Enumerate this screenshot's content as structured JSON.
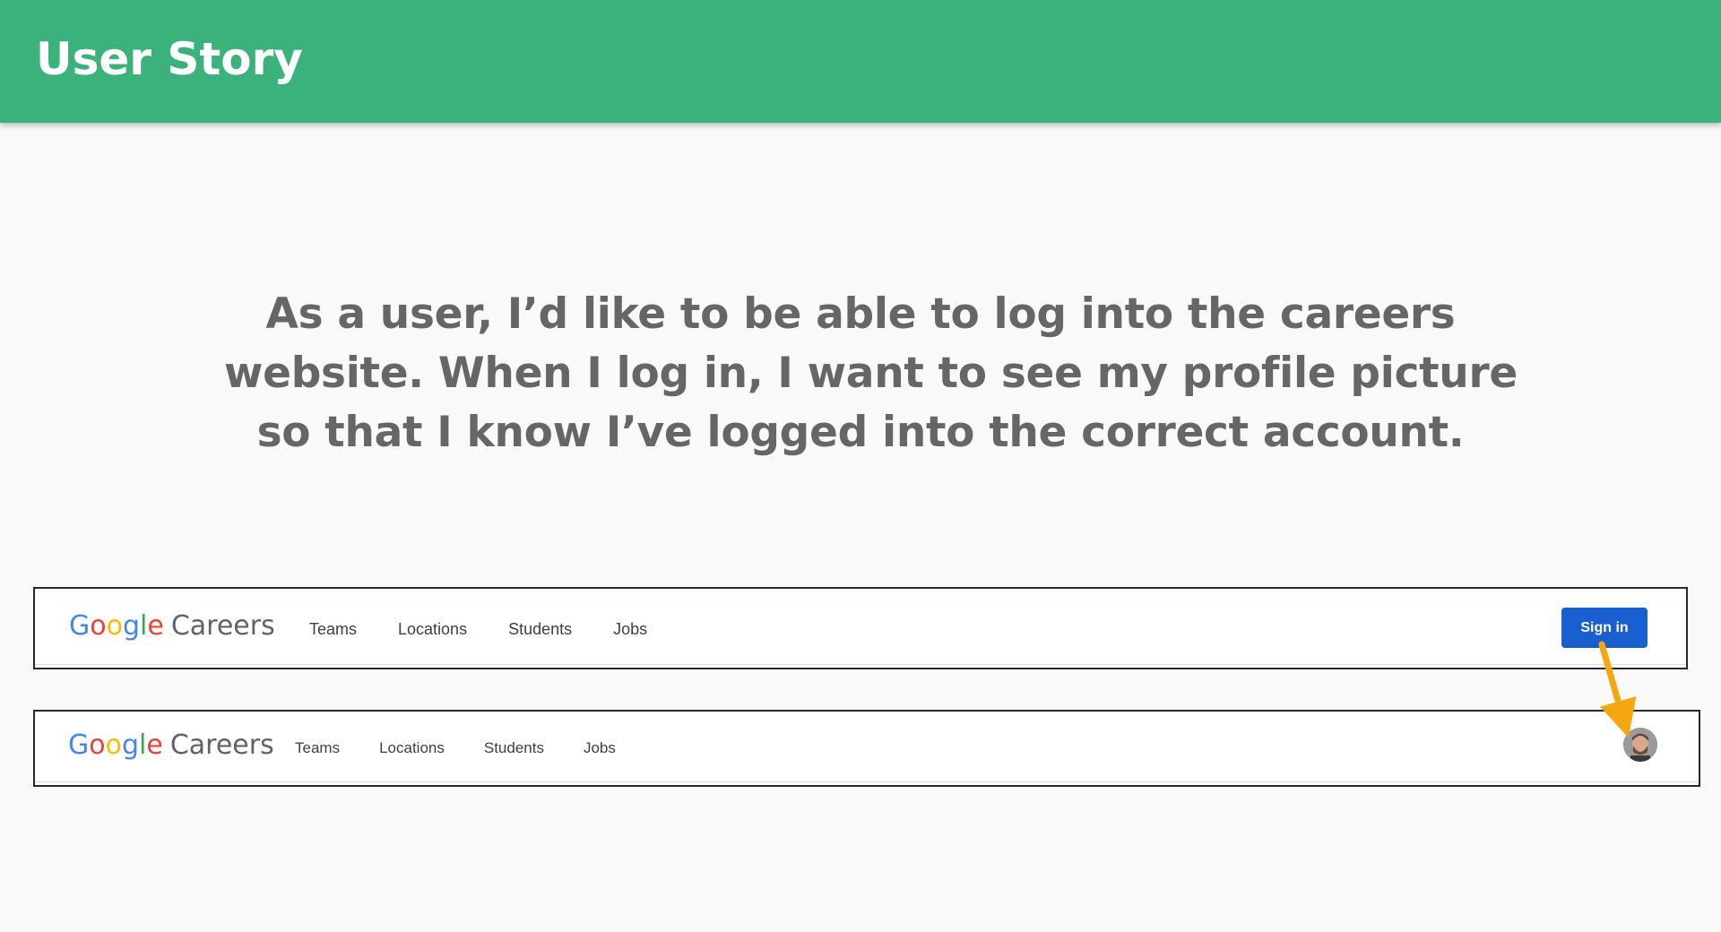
{
  "slide": {
    "title": "User Story",
    "story_lines": [
      "As a user, I’d like to be able to log into the careers",
      "website. When I log in, I want to see my profile picture",
      "so that I know I’ve logged into the correct account."
    ]
  },
  "navbar_before": {
    "logo_word": "Google",
    "logo_suffix": "Careers",
    "menu": [
      "Teams",
      "Locations",
      "Students",
      "Jobs"
    ],
    "sign_in_label": "Sign in"
  },
  "navbar_after": {
    "logo_word": "Google",
    "logo_suffix": "Careers",
    "menu": [
      "Teams",
      "Locations",
      "Students",
      "Jobs"
    ],
    "avatar_icon": "profile-picture-icon"
  },
  "colors": {
    "header_bg": "#3bb27b",
    "story_text": "#666666",
    "sign_in_button": "#1a5fd0",
    "arrow": "#f4a70f"
  }
}
